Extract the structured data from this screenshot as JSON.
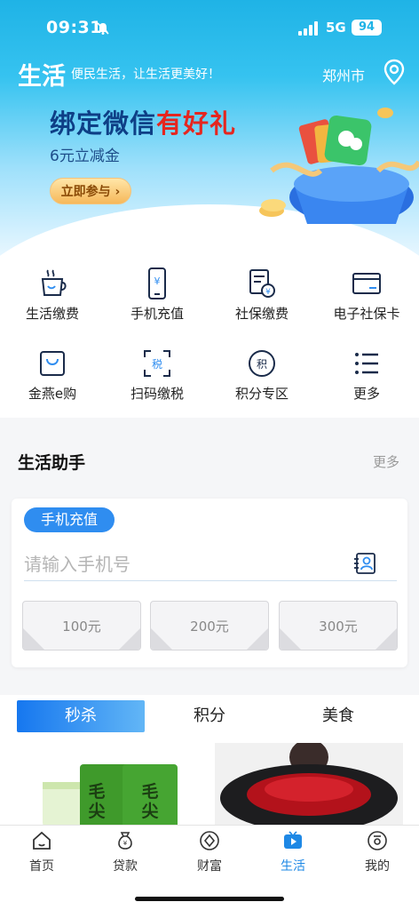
{
  "status": {
    "time": "09:31",
    "network": "5G",
    "battery": "94"
  },
  "header": {
    "title": "生活",
    "slogan": "便民生活，让生活更美好！",
    "city": "郑州市"
  },
  "promo": {
    "title_part1": "绑定微信",
    "title_part2": "有好礼",
    "subtitle": "6元立减金",
    "button": "立即参与"
  },
  "services": [
    {
      "label": "生活缴费",
      "icon": "coffee-cup-icon"
    },
    {
      "label": "手机充值",
      "icon": "phone-recharge-icon"
    },
    {
      "label": "社保缴费",
      "icon": "social-security-icon"
    },
    {
      "label": "电子社保卡",
      "icon": "card-icon"
    },
    {
      "label": "金燕e购",
      "icon": "shopping-bag-icon"
    },
    {
      "label": "扫码缴税",
      "icon": "scan-tax-icon"
    },
    {
      "label": "积分专区",
      "icon": "points-icon"
    },
    {
      "label": "更多",
      "icon": "menu-list-icon"
    }
  ],
  "assistant": {
    "title": "生活助手",
    "more": "更多",
    "tag": "手机充值",
    "input_placeholder": "请输入手机号",
    "amounts": [
      "100元",
      "200元",
      "300元"
    ]
  },
  "tabs": [
    "秒杀",
    "积分",
    "美食"
  ],
  "products": {
    "prod1_text": "毛尖"
  },
  "bottom_nav": [
    "首页",
    "贷款",
    "财富",
    "生活",
    "我的"
  ],
  "colors": {
    "primary": "#1e88e5",
    "hero_top": "#1fb3e6",
    "promo_red": "#e5261f",
    "promo_blue": "#0e3f86"
  }
}
